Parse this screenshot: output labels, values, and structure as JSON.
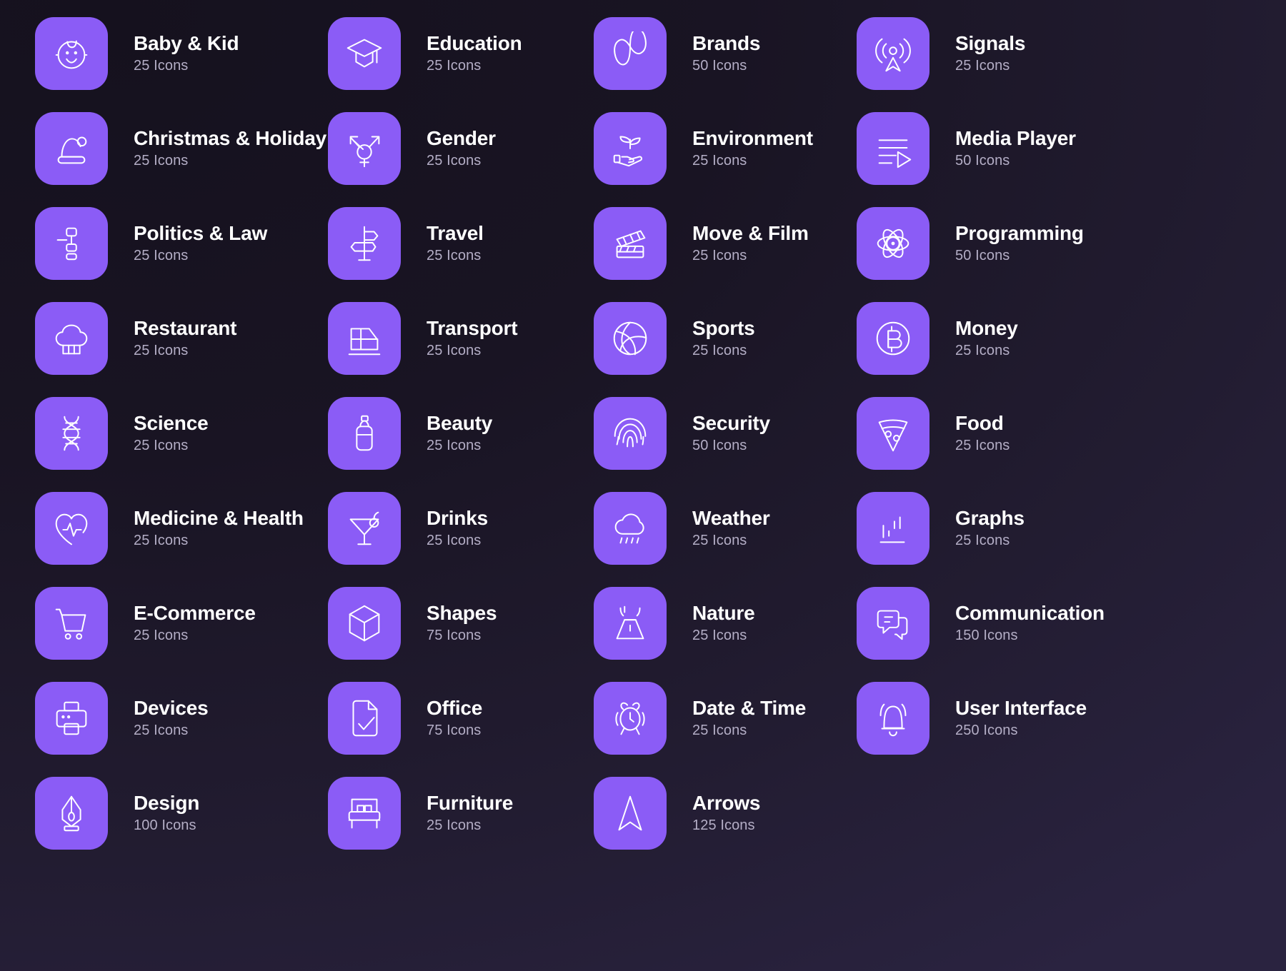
{
  "theme": {
    "background_dark": "#17131f",
    "background_light": "#2a2340",
    "tile_color": "#8b5cf6",
    "title_color": "#ffffff",
    "count_color": "#b4aec6"
  },
  "count_suffix": "Icons",
  "categories": [
    {
      "col": 1,
      "row": 1,
      "name": "Baby & Kid",
      "count": "25 Icons",
      "icon": "baby-face-icon"
    },
    {
      "col": 1,
      "row": 2,
      "name": "Christmas & Holiday",
      "count": "25 Icons",
      "icon": "santa-hat-icon"
    },
    {
      "col": 1,
      "row": 3,
      "name": "Politics & Law",
      "count": "25 Icons",
      "icon": "gavel-icon"
    },
    {
      "col": 1,
      "row": 4,
      "name": "Restaurant",
      "count": "25 Icons",
      "icon": "chef-hat-icon"
    },
    {
      "col": 1,
      "row": 5,
      "name": "Science",
      "count": "25 Icons",
      "icon": "dna-icon"
    },
    {
      "col": 1,
      "row": 6,
      "name": "Medicine & Health",
      "count": "25 Icons",
      "icon": "heart-pulse-icon"
    },
    {
      "col": 1,
      "row": 7,
      "name": "E-Commerce",
      "count": "25 Icons",
      "icon": "shopping-cart-icon"
    },
    {
      "col": 1,
      "row": 8,
      "name": "Devices",
      "count": "25 Icons",
      "icon": "printer-icon"
    },
    {
      "col": 1,
      "row": 9,
      "name": "Design",
      "count": "100 Icons",
      "icon": "pen-nib-icon"
    },
    {
      "col": 2,
      "row": 1,
      "name": "Education",
      "count": "25 Icons",
      "icon": "graduation-cap-icon"
    },
    {
      "col": 2,
      "row": 2,
      "name": "Gender",
      "count": "25 Icons",
      "icon": "transgender-symbol-icon"
    },
    {
      "col": 2,
      "row": 3,
      "name": "Travel",
      "count": "25 Icons",
      "icon": "signpost-icon"
    },
    {
      "col": 2,
      "row": 4,
      "name": "Transport",
      "count": "25 Icons",
      "icon": "train-icon"
    },
    {
      "col": 2,
      "row": 5,
      "name": "Beauty",
      "count": "25 Icons",
      "icon": "lotion-bottle-icon"
    },
    {
      "col": 2,
      "row": 6,
      "name": "Drinks",
      "count": "25 Icons",
      "icon": "cocktail-glass-icon"
    },
    {
      "col": 2,
      "row": 7,
      "name": "Shapes",
      "count": "75 Icons",
      "icon": "cube-icon"
    },
    {
      "col": 2,
      "row": 8,
      "name": "Office",
      "count": "75 Icons",
      "icon": "document-check-icon"
    },
    {
      "col": 2,
      "row": 9,
      "name": "Furniture",
      "count": "25 Icons",
      "icon": "bed-icon"
    },
    {
      "col": 3,
      "row": 1,
      "name": "Brands",
      "count": "50 Icons",
      "icon": "infinity-loop-icon"
    },
    {
      "col": 3,
      "row": 2,
      "name": "Environment",
      "count": "25 Icons",
      "icon": "sprout-hand-icon"
    },
    {
      "col": 3,
      "row": 3,
      "name": "Move & Film",
      "count": "25 Icons",
      "icon": "clapperboard-icon"
    },
    {
      "col": 3,
      "row": 4,
      "name": "Sports",
      "count": "25 Icons",
      "icon": "volleyball-icon"
    },
    {
      "col": 3,
      "row": 5,
      "name": "Security",
      "count": "50 Icons",
      "icon": "fingerprint-icon"
    },
    {
      "col": 3,
      "row": 6,
      "name": "Weather",
      "count": "25 Icons",
      "icon": "rain-cloud-icon"
    },
    {
      "col": 3,
      "row": 7,
      "name": "Nature",
      "count": "25 Icons",
      "icon": "volcano-icon"
    },
    {
      "col": 3,
      "row": 8,
      "name": "Date & Time",
      "count": "25 Icons",
      "icon": "alarm-clock-icon"
    },
    {
      "col": 3,
      "row": 9,
      "name": "Arrows",
      "count": "125 Icons",
      "icon": "navigation-arrow-icon"
    },
    {
      "col": 4,
      "row": 1,
      "name": "Signals",
      "count": "25 Icons",
      "icon": "signal-broadcast-icon"
    },
    {
      "col": 4,
      "row": 2,
      "name": "Media Player",
      "count": "50 Icons",
      "icon": "playlist-play-icon"
    },
    {
      "col": 4,
      "row": 3,
      "name": "Programming",
      "count": "50 Icons",
      "icon": "atom-icon"
    },
    {
      "col": 4,
      "row": 4,
      "name": "Money",
      "count": "25 Icons",
      "icon": "bitcoin-coin-icon"
    },
    {
      "col": 4,
      "row": 5,
      "name": "Food",
      "count": "25 Icons",
      "icon": "pizza-slice-icon"
    },
    {
      "col": 4,
      "row": 6,
      "name": "Graphs",
      "count": "25 Icons",
      "icon": "bar-chart-icon"
    },
    {
      "col": 4,
      "row": 7,
      "name": "Communication",
      "count": "150 Icons",
      "icon": "chat-bubbles-icon"
    },
    {
      "col": 4,
      "row": 8,
      "name": "User Interface",
      "count": "250 Icons",
      "icon": "bell-ring-icon"
    }
  ]
}
